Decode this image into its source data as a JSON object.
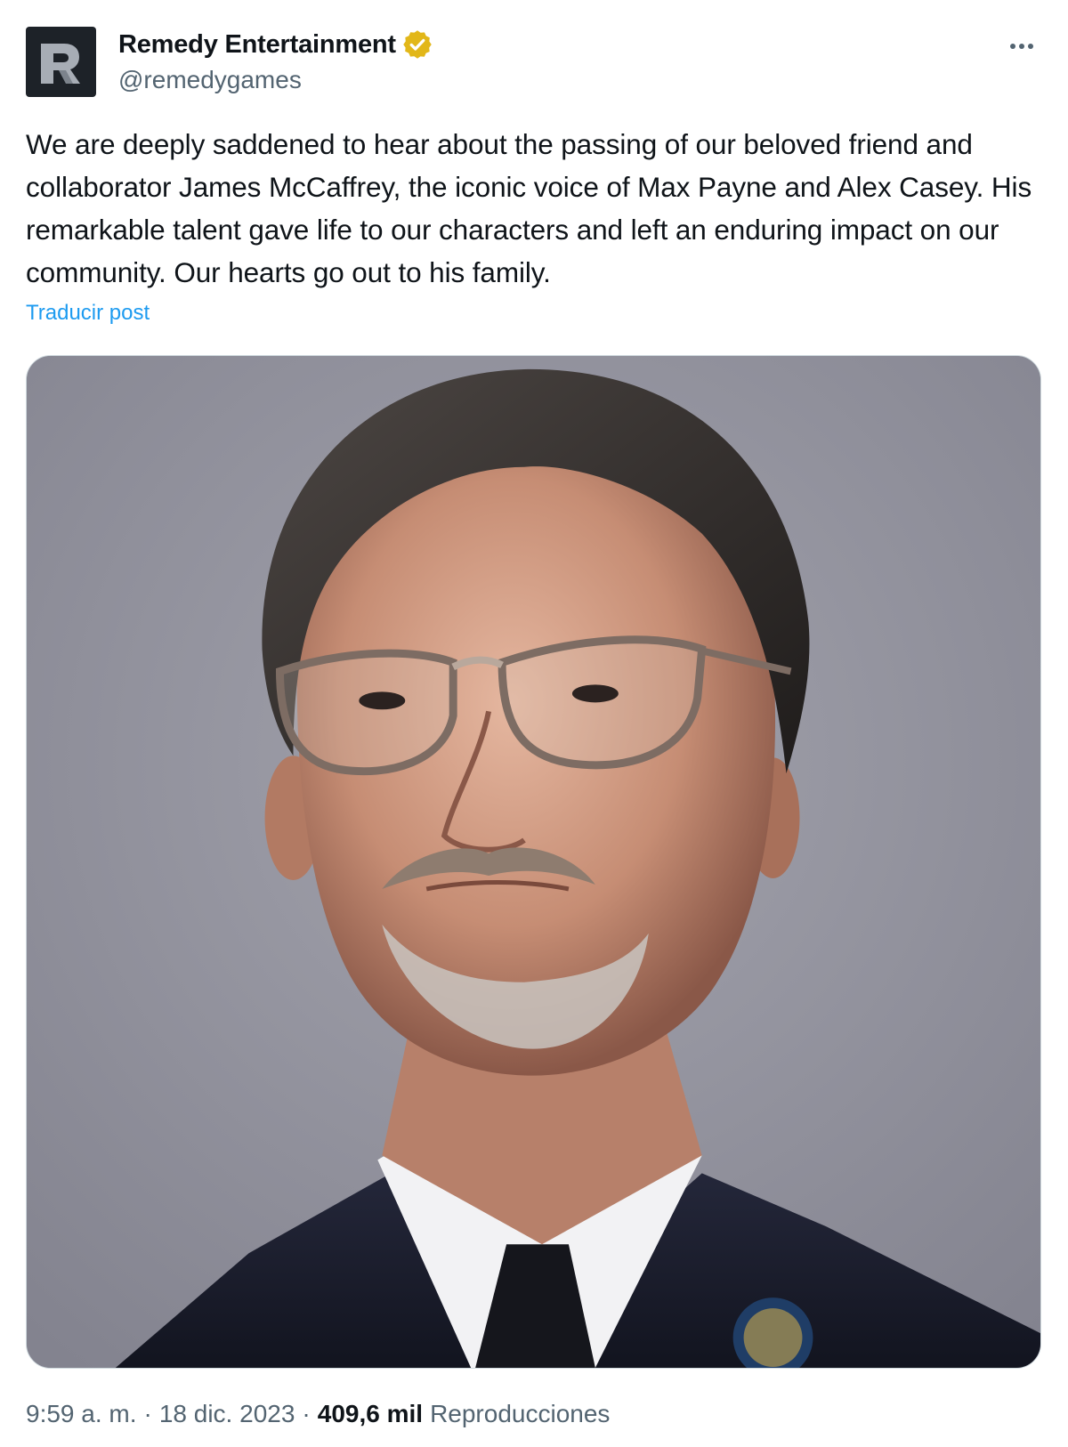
{
  "author": {
    "display_name": "Remedy Entertainment",
    "handle": "@remedygames",
    "avatar_letter": "R",
    "verified_color": "#e2b719"
  },
  "post": {
    "text": "We are deeply saddened to hear about the passing of our beloved friend and collaborator James McCaffrey, the iconic voice of Max Payne and Alex Casey. His remarkable talent gave life to our characters and left an enduring impact on our community. Our hearts go out to his family.",
    "translate_label": "Traducir post"
  },
  "meta": {
    "time": "9:59 a. m.",
    "separator": "·",
    "date": "18 dic. 2023",
    "views_count": "409,6 mil",
    "views_label": "Reproducciones"
  },
  "icons": {
    "more": "more-dots-icon",
    "verified": "verified-badge-icon"
  },
  "colors": {
    "link": "#1d9bf0",
    "secondary_text": "#536471",
    "primary_text": "#0f1419",
    "photo_background": "#8f8f99"
  }
}
